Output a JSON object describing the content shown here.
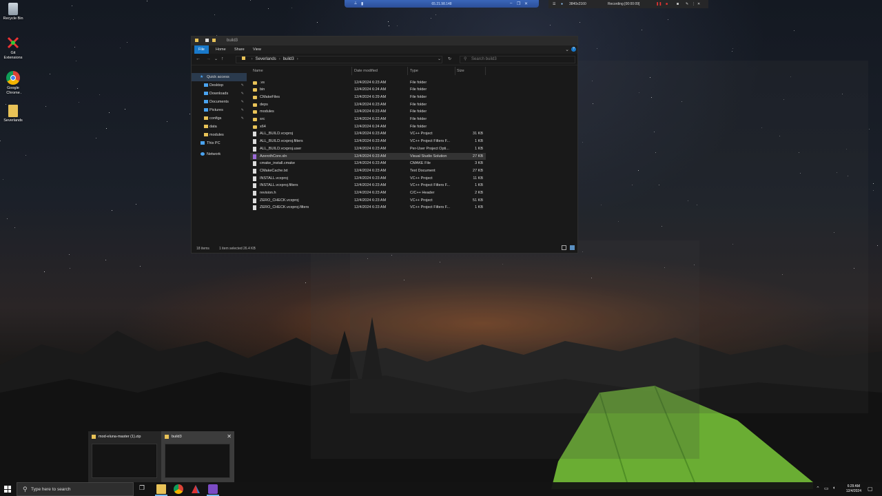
{
  "desktop": {
    "icons": [
      {
        "label": "Recycle Bin",
        "icon": "recycle-bin-icon"
      },
      {
        "label": "Git Extensions",
        "icon": "git-extensions-icon"
      },
      {
        "label": "Google Chrome",
        "icon": "chrome-icon"
      },
      {
        "label": "Severlands",
        "icon": "folder-icon"
      }
    ]
  },
  "remote_bar": {
    "ip": "65.21.98.148"
  },
  "recording_bar": {
    "resolution": "3840x2160",
    "status": "Recording [00:00:09]"
  },
  "explorer": {
    "title": "build3",
    "ribbon_tabs": [
      "File",
      "Home",
      "Share",
      "View"
    ],
    "breadcrumb": [
      "Severlands",
      "build3"
    ],
    "search_placeholder": "Search build3",
    "nav": {
      "quick_access": "Quick access",
      "items": [
        "Desktop",
        "Downloads",
        "Documents",
        "Pictures",
        "configs",
        "data",
        "modules"
      ],
      "this_pc": "This PC",
      "network": "Network"
    },
    "columns": {
      "name": "Name",
      "date": "Date modified",
      "type": "Type",
      "size": "Size"
    },
    "files": [
      {
        "name": ".vs",
        "date": "12/4/2024 6:23 AM",
        "type": "File folder",
        "size": "",
        "kind": "folder"
      },
      {
        "name": "bin",
        "date": "12/4/2024 6:24 AM",
        "type": "File folder",
        "size": "",
        "kind": "folder"
      },
      {
        "name": "CMakeFiles",
        "date": "12/4/2024 6:29 AM",
        "type": "File folder",
        "size": "",
        "kind": "folder"
      },
      {
        "name": "deps",
        "date": "12/4/2024 6:23 AM",
        "type": "File folder",
        "size": "",
        "kind": "folder"
      },
      {
        "name": "modules",
        "date": "12/4/2024 6:23 AM",
        "type": "File folder",
        "size": "",
        "kind": "folder"
      },
      {
        "name": "src",
        "date": "12/4/2024 6:23 AM",
        "type": "File folder",
        "size": "",
        "kind": "folder"
      },
      {
        "name": "x64",
        "date": "12/4/2024 6:24 AM",
        "type": "File folder",
        "size": "",
        "kind": "folder"
      },
      {
        "name": "ALL_BUILD.vcxproj",
        "date": "12/4/2024 6:23 AM",
        "type": "VC++ Project",
        "size": "31 KB",
        "kind": "file"
      },
      {
        "name": "ALL_BUILD.vcxproj.filters",
        "date": "12/4/2024 6:23 AM",
        "type": "VC++ Project Filters F...",
        "size": "1 KB",
        "kind": "file"
      },
      {
        "name": "ALL_BUILD.vcxproj.user",
        "date": "12/4/2024 6:23 AM",
        "type": "Per-User Project Opti...",
        "size": "1 KB",
        "kind": "file"
      },
      {
        "name": "AzerothCore.sln",
        "date": "12/4/2024 6:23 AM",
        "type": "Visual Studio Solution",
        "size": "27 KB",
        "kind": "vs",
        "selected": true
      },
      {
        "name": "cmake_install.cmake",
        "date": "12/4/2024 6:23 AM",
        "type": "CMAKE File",
        "size": "3 KB",
        "kind": "file"
      },
      {
        "name": "CMakeCache.txt",
        "date": "12/4/2024 6:23 AM",
        "type": "Text Document",
        "size": "27 KB",
        "kind": "file"
      },
      {
        "name": "INSTALL.vcxproj",
        "date": "12/4/2024 6:23 AM",
        "type": "VC++ Project",
        "size": "11 KB",
        "kind": "file"
      },
      {
        "name": "INSTALL.vcxproj.filters",
        "date": "12/4/2024 6:23 AM",
        "type": "VC++ Project Filters F...",
        "size": "1 KB",
        "kind": "file"
      },
      {
        "name": "revision.h",
        "date": "12/4/2024 6:23 AM",
        "type": "C/C++ Header",
        "size": "2 KB",
        "kind": "file"
      },
      {
        "name": "ZERO_CHECK.vcxproj",
        "date": "12/4/2024 6:23 AM",
        "type": "VC++ Project",
        "size": "51 KB",
        "kind": "file"
      },
      {
        "name": "ZERO_CHECK.vcxproj.filters",
        "date": "12/4/2024 6:23 AM",
        "type": "VC++ Project Filters F...",
        "size": "1 KB",
        "kind": "file"
      }
    ],
    "status": {
      "count": "18 items",
      "selection": "1 item selected  26.4 KB"
    }
  },
  "thumbnails": [
    {
      "label": "mod-eluna-master (1).zip"
    },
    {
      "label": "build3"
    }
  ],
  "taskbar": {
    "search_placeholder": "Type here to search",
    "time": "6:29 AM",
    "date": "12/4/2024"
  }
}
